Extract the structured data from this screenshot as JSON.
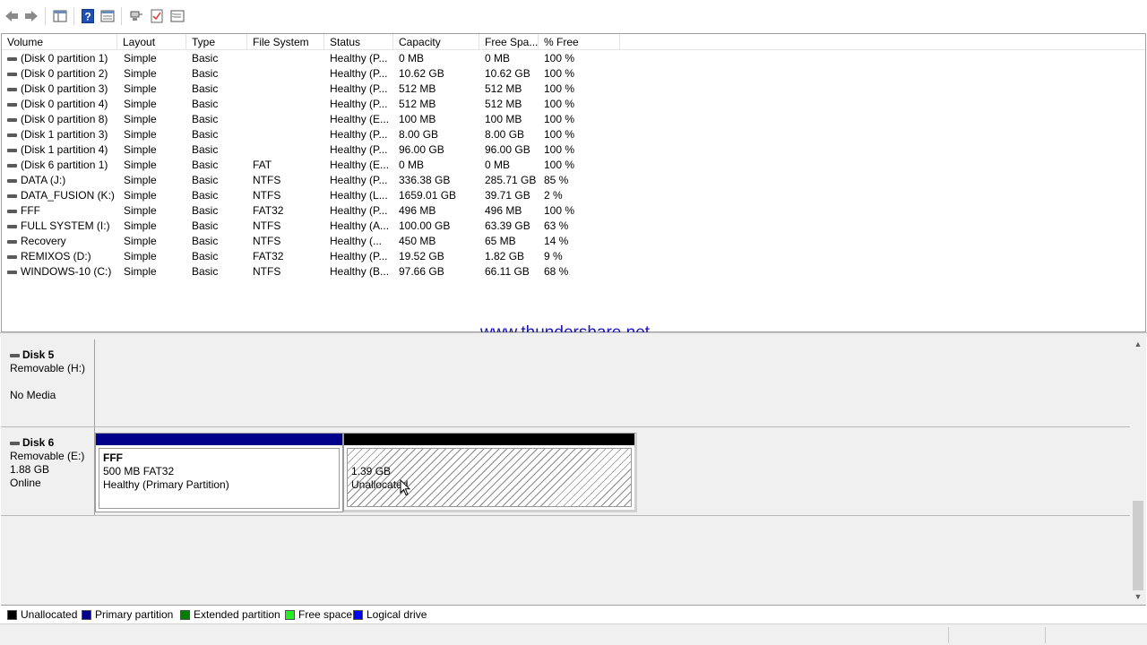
{
  "toolbar": {
    "buttons": [
      {
        "icon": "back-arrow-icon"
      },
      {
        "icon": "forward-arrow-icon"
      },
      {
        "icon": "show-hide-console-tree-icon"
      },
      {
        "icon": "help-icon"
      },
      {
        "icon": "properties-icon"
      },
      {
        "icon": "connect-icon"
      },
      {
        "icon": "check-icon"
      },
      {
        "icon": "settings-list-icon"
      }
    ]
  },
  "columns": [
    "Volume",
    "Layout",
    "Type",
    "File System",
    "Status",
    "Capacity",
    "Free Spa...",
    "% Free"
  ],
  "volumes": [
    [
      "(Disk 0 partition 1)",
      "Simple",
      "Basic",
      "",
      "Healthy (P...",
      "0 MB",
      "0 MB",
      "100 %"
    ],
    [
      "(Disk 0 partition 2)",
      "Simple",
      "Basic",
      "",
      "Healthy (P...",
      "10.62 GB",
      "10.62 GB",
      "100 %"
    ],
    [
      "(Disk 0 partition 3)",
      "Simple",
      "Basic",
      "",
      "Healthy (P...",
      "512 MB",
      "512 MB",
      "100 %"
    ],
    [
      "(Disk 0 partition 4)",
      "Simple",
      "Basic",
      "",
      "Healthy (P...",
      "512 MB",
      "512 MB",
      "100 %"
    ],
    [
      "(Disk 0 partition 8)",
      "Simple",
      "Basic",
      "",
      "Healthy (E...",
      "100 MB",
      "100 MB",
      "100 %"
    ],
    [
      "(Disk 1 partition 3)",
      "Simple",
      "Basic",
      "",
      "Healthy (P...",
      "8.00 GB",
      "8.00 GB",
      "100 %"
    ],
    [
      "(Disk 1 partition 4)",
      "Simple",
      "Basic",
      "",
      "Healthy (P...",
      "96.00 GB",
      "96.00 GB",
      "100 %"
    ],
    [
      "(Disk 6 partition 1)",
      "Simple",
      "Basic",
      "FAT",
      "Healthy (E...",
      "0 MB",
      "0 MB",
      "100 %"
    ],
    [
      "DATA (J:)",
      "Simple",
      "Basic",
      "NTFS",
      "Healthy (P...",
      "336.38 GB",
      "285.71 GB",
      "85 %"
    ],
    [
      "DATA_FUSION (K:)",
      "Simple",
      "Basic",
      "NTFS",
      "Healthy (L...",
      "1659.01 GB",
      "39.71 GB",
      "2 %"
    ],
    [
      "FFF",
      "Simple",
      "Basic",
      "FAT32",
      "Healthy (P...",
      "496 MB",
      "496 MB",
      "100 %"
    ],
    [
      "FULL SYSTEM (I:)",
      "Simple",
      "Basic",
      "NTFS",
      "Healthy (A...",
      "100.00 GB",
      "63.39 GB",
      "63 %"
    ],
    [
      "Recovery",
      "Simple",
      "Basic",
      "NTFS",
      "Healthy (...",
      "450 MB",
      "65 MB",
      "14 %"
    ],
    [
      "REMIXOS (D:)",
      "Simple",
      "Basic",
      "FAT32",
      "Healthy (P...",
      "19.52 GB",
      "1.82 GB",
      "9 %"
    ],
    [
      "WINDOWS-10 (C:)",
      "Simple",
      "Basic",
      "NTFS",
      "Healthy (B...",
      "97.66 GB",
      "66.11 GB",
      "68 %"
    ]
  ],
  "watermark": "www.thundershare.net",
  "disks": {
    "disk5": {
      "title": "Disk 5",
      "line1": "Removable (H:)",
      "line2": "",
      "line3": "No Media"
    },
    "disk6": {
      "title": "Disk 6",
      "line1": "Removable (E:)",
      "line2": "1.88 GB",
      "line3": "Online"
    }
  },
  "partitions": {
    "fff": {
      "name": "FFF",
      "size_fs": "500 MB FAT32",
      "status": "Healthy (Primary Partition)",
      "bar_color": "#00008b"
    },
    "unallocated": {
      "size": "1.39 GB",
      "status": "Unallocated",
      "bar_color": "#000000"
    }
  },
  "legend": [
    {
      "label": "Unallocated",
      "color": "#000000"
    },
    {
      "label": "Primary partition",
      "color": "#00008b"
    },
    {
      "label": "Extended partition",
      "color": "#007c00"
    },
    {
      "label": "Free space",
      "color": "#22ee22"
    },
    {
      "label": "Logical drive",
      "color": "#0000ff"
    }
  ]
}
